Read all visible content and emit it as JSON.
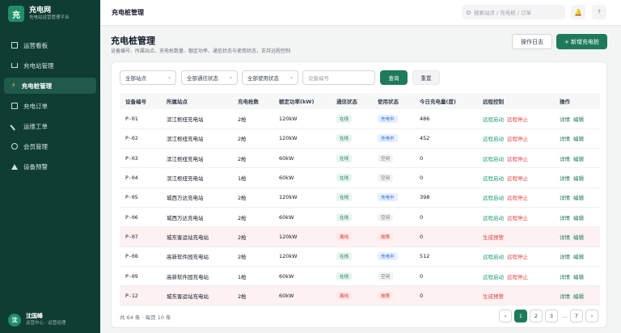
{
  "brand": {
    "logo": "充",
    "title": "充电网",
    "subtitle": "充电站运营管理平台"
  },
  "sidebar": {
    "items": [
      {
        "label": "运营看板",
        "icon": "grid-icon"
      },
      {
        "label": "充电站管理",
        "icon": "home-icon"
      },
      {
        "label": "充电桩管理",
        "icon": "bolt-icon",
        "active": true
      },
      {
        "label": "充电订单",
        "icon": "document-icon"
      },
      {
        "label": "运维工单",
        "icon": "wrench-icon"
      },
      {
        "label": "会员管理",
        "icon": "user-icon"
      },
      {
        "label": "设备预警",
        "icon": "warning-icon"
      }
    ]
  },
  "user": {
    "avatar": "沈",
    "name": "沈国峰",
    "role": "运营中心 · 运营经理"
  },
  "topbar": {
    "title": "充电桩管理",
    "search_placeholder": "搜索站点 / 充电桩 / 订单",
    "notify_icon": "🔔",
    "help_label": "?"
  },
  "header": {
    "title": "充电桩管理",
    "subtitle": "设备编号、所属站点、充电枪数量、额定功率、通信状态与使用状态，支持远程控制",
    "log_button": "操作日志",
    "add_button": "+ 新增充电桩"
  },
  "filters": {
    "station": "全部站点",
    "comm": "全部通信状态",
    "usage": "全部使用状态",
    "device_placeholder": "设备编号",
    "query": "查询",
    "reset": "重置"
  },
  "table": {
    "columns": [
      "设备编号",
      "所属站点",
      "充电枪数",
      "额定功率(kW)",
      "通信状态",
      "使用状态",
      "今日充电量(度)",
      "远程控制",
      "操作"
    ],
    "rows": [
      {
        "id": "P-01",
        "station": "滨江枢纽充电站",
        "guns": "2枪",
        "power": "120kW",
        "comm": "在线",
        "usage": "充电中",
        "energy": "486",
        "ctrl": [
          "远程启动",
          "远程停止"
        ],
        "ops": [
          "详情",
          "编辑"
        ],
        "alert": false
      },
      {
        "id": "P-02",
        "station": "滨江枢纽充电站",
        "guns": "2枪",
        "power": "120kW",
        "comm": "在线",
        "usage": "充电中",
        "energy": "452",
        "ctrl": [
          "远程启动",
          "远程停止"
        ],
        "ops": [
          "详情",
          "编辑"
        ],
        "alert": false
      },
      {
        "id": "P-03",
        "station": "滨江枢纽充电站",
        "guns": "2枪",
        "power": "60kW",
        "comm": "在线",
        "usage": "空闲",
        "energy": "0",
        "ctrl": [
          "远程启动",
          "远程停止"
        ],
        "ops": [
          "详情",
          "编辑"
        ],
        "alert": false
      },
      {
        "id": "P-04",
        "station": "滨江枢纽充电站",
        "guns": "1枪",
        "power": "60kW",
        "comm": "在线",
        "usage": "空闲",
        "energy": "0",
        "ctrl": [
          "远程启动",
          "远程停止"
        ],
        "ops": [
          "详情",
          "编辑"
        ],
        "alert": false
      },
      {
        "id": "P-05",
        "station": "城西万达充电站",
        "guns": "2枪",
        "power": "120kW",
        "comm": "在线",
        "usage": "充电中",
        "energy": "398",
        "ctrl": [
          "远程启动",
          "远程停止"
        ],
        "ops": [
          "详情",
          "编辑"
        ],
        "alert": false
      },
      {
        "id": "P-06",
        "station": "城西万达充电站",
        "guns": "2枪",
        "power": "60kW",
        "comm": "在线",
        "usage": "空闲",
        "energy": "0",
        "ctrl": [
          "远程启动",
          "远程停止"
        ],
        "ops": [
          "详情",
          "编辑"
        ],
        "alert": false
      },
      {
        "id": "P-07",
        "station": "城东客运站充电站",
        "guns": "2枪",
        "power": "120kW",
        "comm": "离线",
        "usage": "故障",
        "energy": "0",
        "ctrl": [
          "生成预警"
        ],
        "ops": [
          "详情",
          "编辑"
        ],
        "alert": true
      },
      {
        "id": "P-08",
        "station": "高新软件园充电站",
        "guns": "2枪",
        "power": "120kW",
        "comm": "在线",
        "usage": "充电中",
        "energy": "512",
        "ctrl": [
          "远程启动",
          "远程停止"
        ],
        "ops": [
          "详情",
          "编辑"
        ],
        "alert": false
      },
      {
        "id": "P-09",
        "station": "高新软件园充电站",
        "guns": "1枪",
        "power": "60kW",
        "comm": "在线",
        "usage": "空闲",
        "energy": "0",
        "ctrl": [
          "远程启动",
          "远程停止"
        ],
        "ops": [
          "详情",
          "编辑"
        ],
        "alert": false
      },
      {
        "id": "P-12",
        "station": "城东客运站充电站",
        "guns": "2枪",
        "power": "60kW",
        "comm": "离线",
        "usage": "故障",
        "energy": "0",
        "ctrl": [
          "生成预警"
        ],
        "ops": [
          "详情",
          "编辑"
        ],
        "alert": true
      }
    ]
  },
  "pagination": {
    "summary": "共 64 条 · 每页 10 条",
    "prev": "‹",
    "pages": [
      "1",
      "2",
      "3"
    ],
    "ellipsis": "…",
    "last": "7",
    "next": "›",
    "current": "1"
  },
  "colors": {
    "primary": "#1f7a5c",
    "sidebar": "#0f3d33",
    "danger": "#e04848"
  }
}
